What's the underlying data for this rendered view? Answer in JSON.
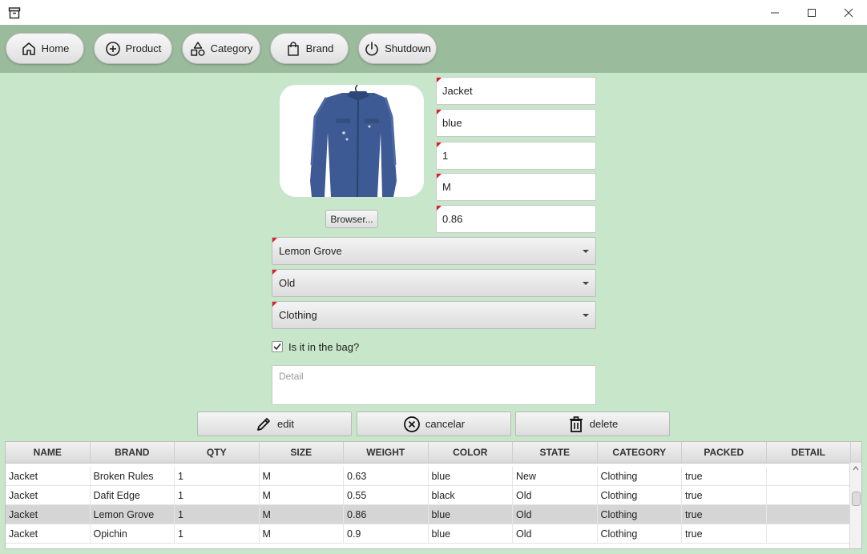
{
  "window": {
    "minimize": "minimize",
    "maximize": "maximize",
    "close": "close"
  },
  "toolbar": {
    "buttons": [
      {
        "label": "Home",
        "icon": "home-icon"
      },
      {
        "label": "Product",
        "icon": "plus-circle-icon"
      },
      {
        "label": "Category",
        "icon": "shapes-icon"
      },
      {
        "label": "Brand",
        "icon": "shopping-bag-icon"
      },
      {
        "label": "Shutdown",
        "icon": "power-icon"
      }
    ]
  },
  "form": {
    "name": "Jacket",
    "color": "blue",
    "quantity": "1",
    "size": "M",
    "weight": "0.86",
    "browse_label": "Browser...",
    "brand": "Lemon Grove",
    "state": "Old",
    "category": "Clothing",
    "packed_label": "Is it in the bag?",
    "packed_checked": true,
    "detail_placeholder": "Detail"
  },
  "actions": {
    "edit": "edit",
    "cancel": "cancelar",
    "delete": "delete"
  },
  "table": {
    "columns": [
      "NAME",
      "BRAND",
      "QTY",
      "SIZE",
      "WEIGHT",
      "COLOR",
      "STATE",
      "CATEGORY",
      "PACKED",
      "DETAIL"
    ],
    "rows": [
      [
        "Jacket",
        "Broken Rules",
        "1",
        "M",
        "0.63",
        "blue",
        "New",
        "Clothing",
        "true",
        ""
      ],
      [
        "Jacket",
        "Dafit Edge",
        "1",
        "M",
        "0.55",
        "black",
        "Old",
        "Clothing",
        "true",
        ""
      ],
      [
        "Jacket",
        "Lemon Grove",
        "1",
        "M",
        "0.86",
        "blue",
        "Old",
        "Clothing",
        "true",
        ""
      ],
      [
        "Jacket",
        "Opichin",
        "1",
        "M",
        "0.9",
        "blue",
        "Old",
        "Clothing",
        "true",
        ""
      ]
    ],
    "selected_row_index": 2
  },
  "colors": {
    "background": "#c8e6c9",
    "toolbar": "#9bbb9d",
    "required_marker": "#e02020"
  }
}
